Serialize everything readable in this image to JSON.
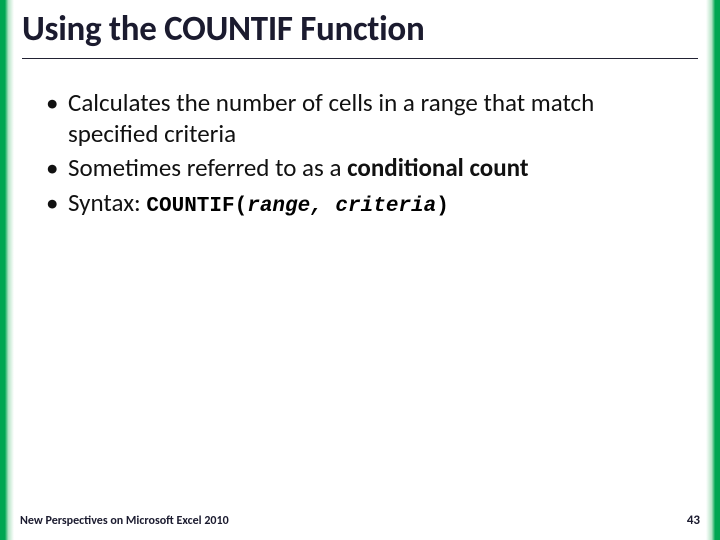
{
  "title": "Using the COUNTIF Function",
  "bullets": {
    "b1": "Calculates the number of cells in a range that match specified criteria",
    "b2_pre": "Sometimes referred to as a ",
    "b2_bold": "conditional count",
    "b3_label": "Syntax: ",
    "b3_func": "COUNTIF(",
    "b3_args": "range, criteria",
    "b3_close": ")"
  },
  "footer": {
    "left": "New Perspectives on Microsoft Excel 2010",
    "page": "43"
  }
}
